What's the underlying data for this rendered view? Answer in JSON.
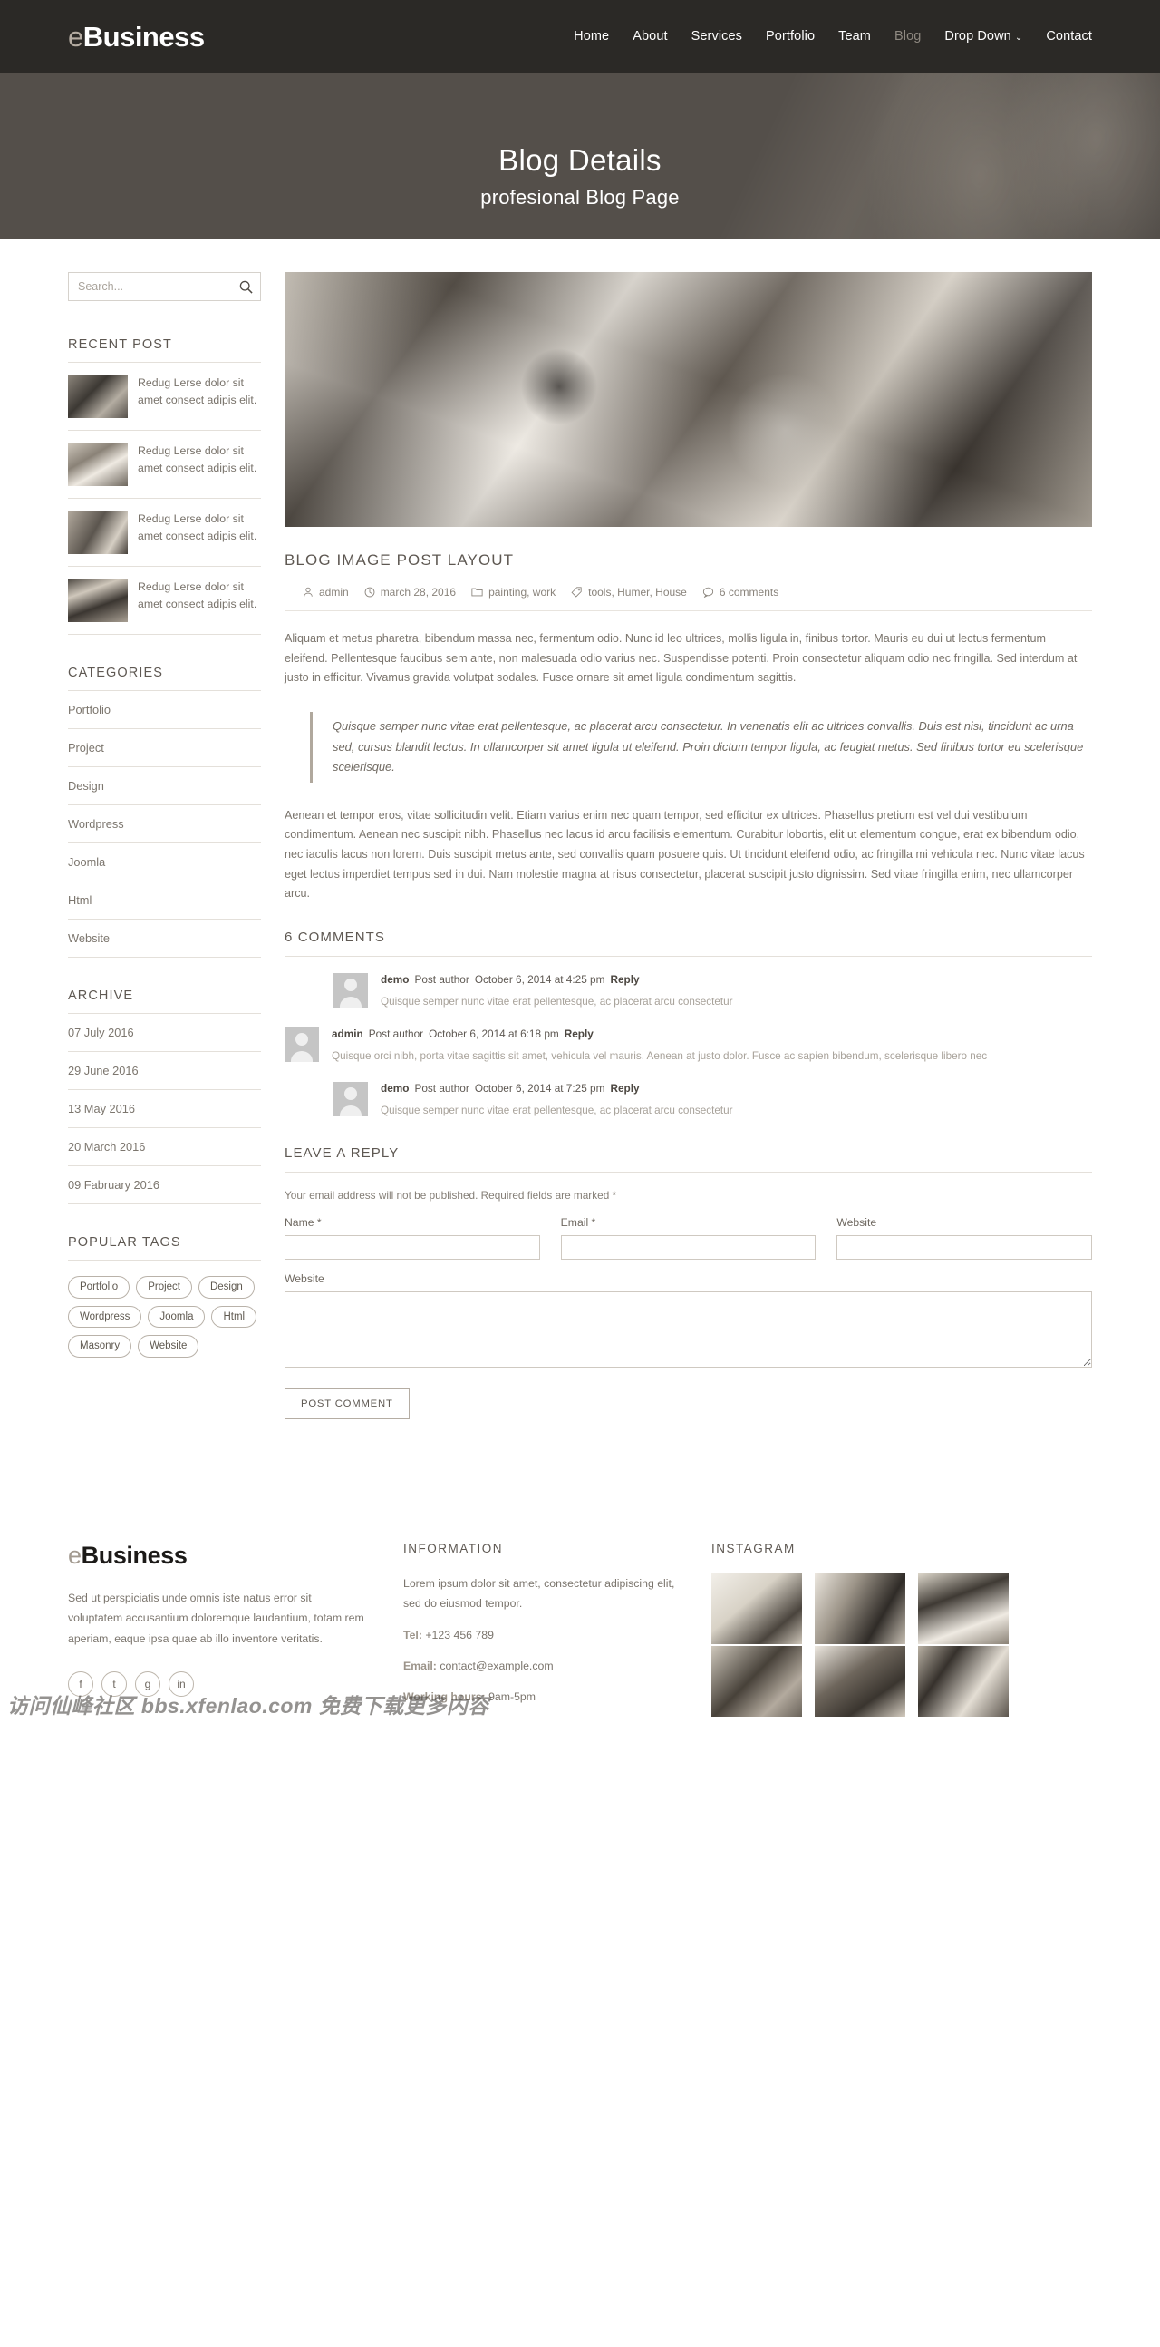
{
  "header": {
    "brand_prefix": "e",
    "brand_main": "Business",
    "nav": [
      {
        "label": "Home",
        "active": false
      },
      {
        "label": "About",
        "active": false
      },
      {
        "label": "Services",
        "active": false
      },
      {
        "label": "Portfolio",
        "active": false
      },
      {
        "label": "Team",
        "active": false
      },
      {
        "label": "Blog",
        "active": true
      },
      {
        "label": "Drop Down",
        "active": false,
        "caret": "⌄"
      },
      {
        "label": "Contact",
        "active": false
      }
    ]
  },
  "hero": {
    "title": "Blog Details",
    "subtitle": "profesional Blog Page"
  },
  "sidebar": {
    "search": {
      "placeholder": "Search...",
      "value": "",
      "icon": "search-icon"
    },
    "recent": {
      "title": "RECENT POST",
      "items": [
        {
          "text": "Redug Lerse dolor sit amet consect adipis elit."
        },
        {
          "text": "Redug Lerse dolor sit amet consect adipis elit."
        },
        {
          "text": "Redug Lerse dolor sit amet consect adipis elit."
        },
        {
          "text": "Redug Lerse dolor sit amet consect adipis elit."
        }
      ]
    },
    "categories": {
      "title": "CATEGORIES",
      "items": [
        "Portfolio",
        "Project",
        "Design",
        "Wordpress",
        "Joomla",
        "Html",
        "Website"
      ]
    },
    "archive": {
      "title": "ARCHIVE",
      "items": [
        "07 July 2016",
        "29 June 2016",
        "13 May 2016",
        "20 March 2016",
        "09 Fabruary 2016"
      ]
    },
    "tags": {
      "title": "POPULAR TAGS",
      "items": [
        "Portfolio",
        "Project",
        "Design",
        "Wordpress",
        "Joomla",
        "Html",
        "Masonry",
        "Website"
      ]
    }
  },
  "post": {
    "title": "BLOG IMAGE POST LAYOUT",
    "meta": {
      "author": "admin",
      "date": "march 28, 2016",
      "categories": "painting, work",
      "tags": "tools, Humer, House",
      "comments": "6 comments"
    },
    "paragraph1": "Aliquam et metus pharetra, bibendum massa nec, fermentum odio. Nunc id leo ultrices, mollis ligula in, finibus tortor. Mauris eu dui ut lectus fermentum eleifend. Pellentesque faucibus sem ante, non malesuada odio varius nec. Suspendisse potenti. Proin consectetur aliquam odio nec fringilla. Sed interdum at justo in efficitur. Vivamus gravida volutpat sodales. Fusce ornare sit amet ligula condimentum sagittis.",
    "quote": "Quisque semper nunc vitae erat pellentesque, ac placerat arcu consectetur. In venenatis elit ac ultrices convallis. Duis est nisi, tincidunt ac urna sed, cursus blandit lectus. In ullamcorper sit amet ligula ut eleifend. Proin dictum tempor ligula, ac feugiat metus. Sed finibus tortor eu scelerisque scelerisque.",
    "paragraph2": "Aenean et tempor eros, vitae sollicitudin velit. Etiam varius enim nec quam tempor, sed efficitur ex ultrices. Phasellus pretium est vel dui vestibulum condimentum. Aenean nec suscipit nibh. Phasellus nec lacus id arcu facilisis elementum. Curabitur lobortis, elit ut elementum congue, erat ex bibendum odio, nec iaculis lacus non lorem. Duis suscipit metus ante, sed convallis quam posuere quis. Ut tincidunt eleifend odio, ac fringilla mi vehicula nec. Nunc vitae lacus eget lectus imperdiet tempus sed in dui. Nam molestie magna at risus consectetur, placerat suscipit justo dignissim. Sed vitae fringilla enim, nec ullamcorper arcu."
  },
  "comments": {
    "title": "6 COMMENTS",
    "items": [
      {
        "author": "demo",
        "post_author": "Post author",
        "date": "October 6, 2014 at 4:25 pm",
        "reply": "Reply",
        "text": "Quisque semper nunc vitae erat pellentesque, ac placerat arcu consectetur",
        "level": 1
      },
      {
        "author": "admin",
        "post_author": "Post author",
        "date": "October 6, 2014 at 6:18 pm",
        "reply": "Reply",
        "text": "Quisque orci nibh, porta vitae sagittis sit amet, vehicula vel mauris. Aenean at justo dolor. Fusce ac sapien bibendum, scelerisque libero nec",
        "level": 0
      },
      {
        "author": "demo",
        "post_author": "Post author",
        "date": "October 6, 2014 at 7:25 pm",
        "reply": "Reply",
        "text": "Quisque semper nunc vitae erat pellentesque, ac placerat arcu consectetur",
        "level": 1
      }
    ]
  },
  "reply_form": {
    "title": "LEAVE A REPLY",
    "note": "Your email address will not be published. Required fields are marked *",
    "name_label": "Name *",
    "name_value": "",
    "email_label": "Email *",
    "email_value": "",
    "website_label": "Website",
    "website_value": "",
    "message_label": "Website",
    "message_value": "",
    "submit_label": "POST COMMENT"
  },
  "footer": {
    "brand_prefix": "e",
    "brand_main": "Business",
    "about": "Sed ut perspiciatis unde omnis iste natus error sit voluptatem accusantium doloremque laudantium, totam rem aperiam, eaque ipsa quae ab illo inventore veritatis.",
    "socials": [
      "facebook-icon",
      "twitter-icon",
      "google-plus-icon",
      "linkedin-icon"
    ],
    "information": {
      "title": "INFORMATION",
      "text": "Lorem ipsum dolor sit amet, consectetur adipiscing elit, sed do eiusmod tempor.",
      "tel_label": "Tel:",
      "tel_value": "+123 456 789",
      "email_label": "Email:",
      "email_value": "contact@example.com",
      "hours_label": "Working hours:",
      "hours_value": "9am-5pm"
    },
    "instagram": {
      "title": "INSTAGRAM"
    },
    "watermark": "访问仙峰社区 bbs.xfenlao.com 免费下载更多内容"
  }
}
